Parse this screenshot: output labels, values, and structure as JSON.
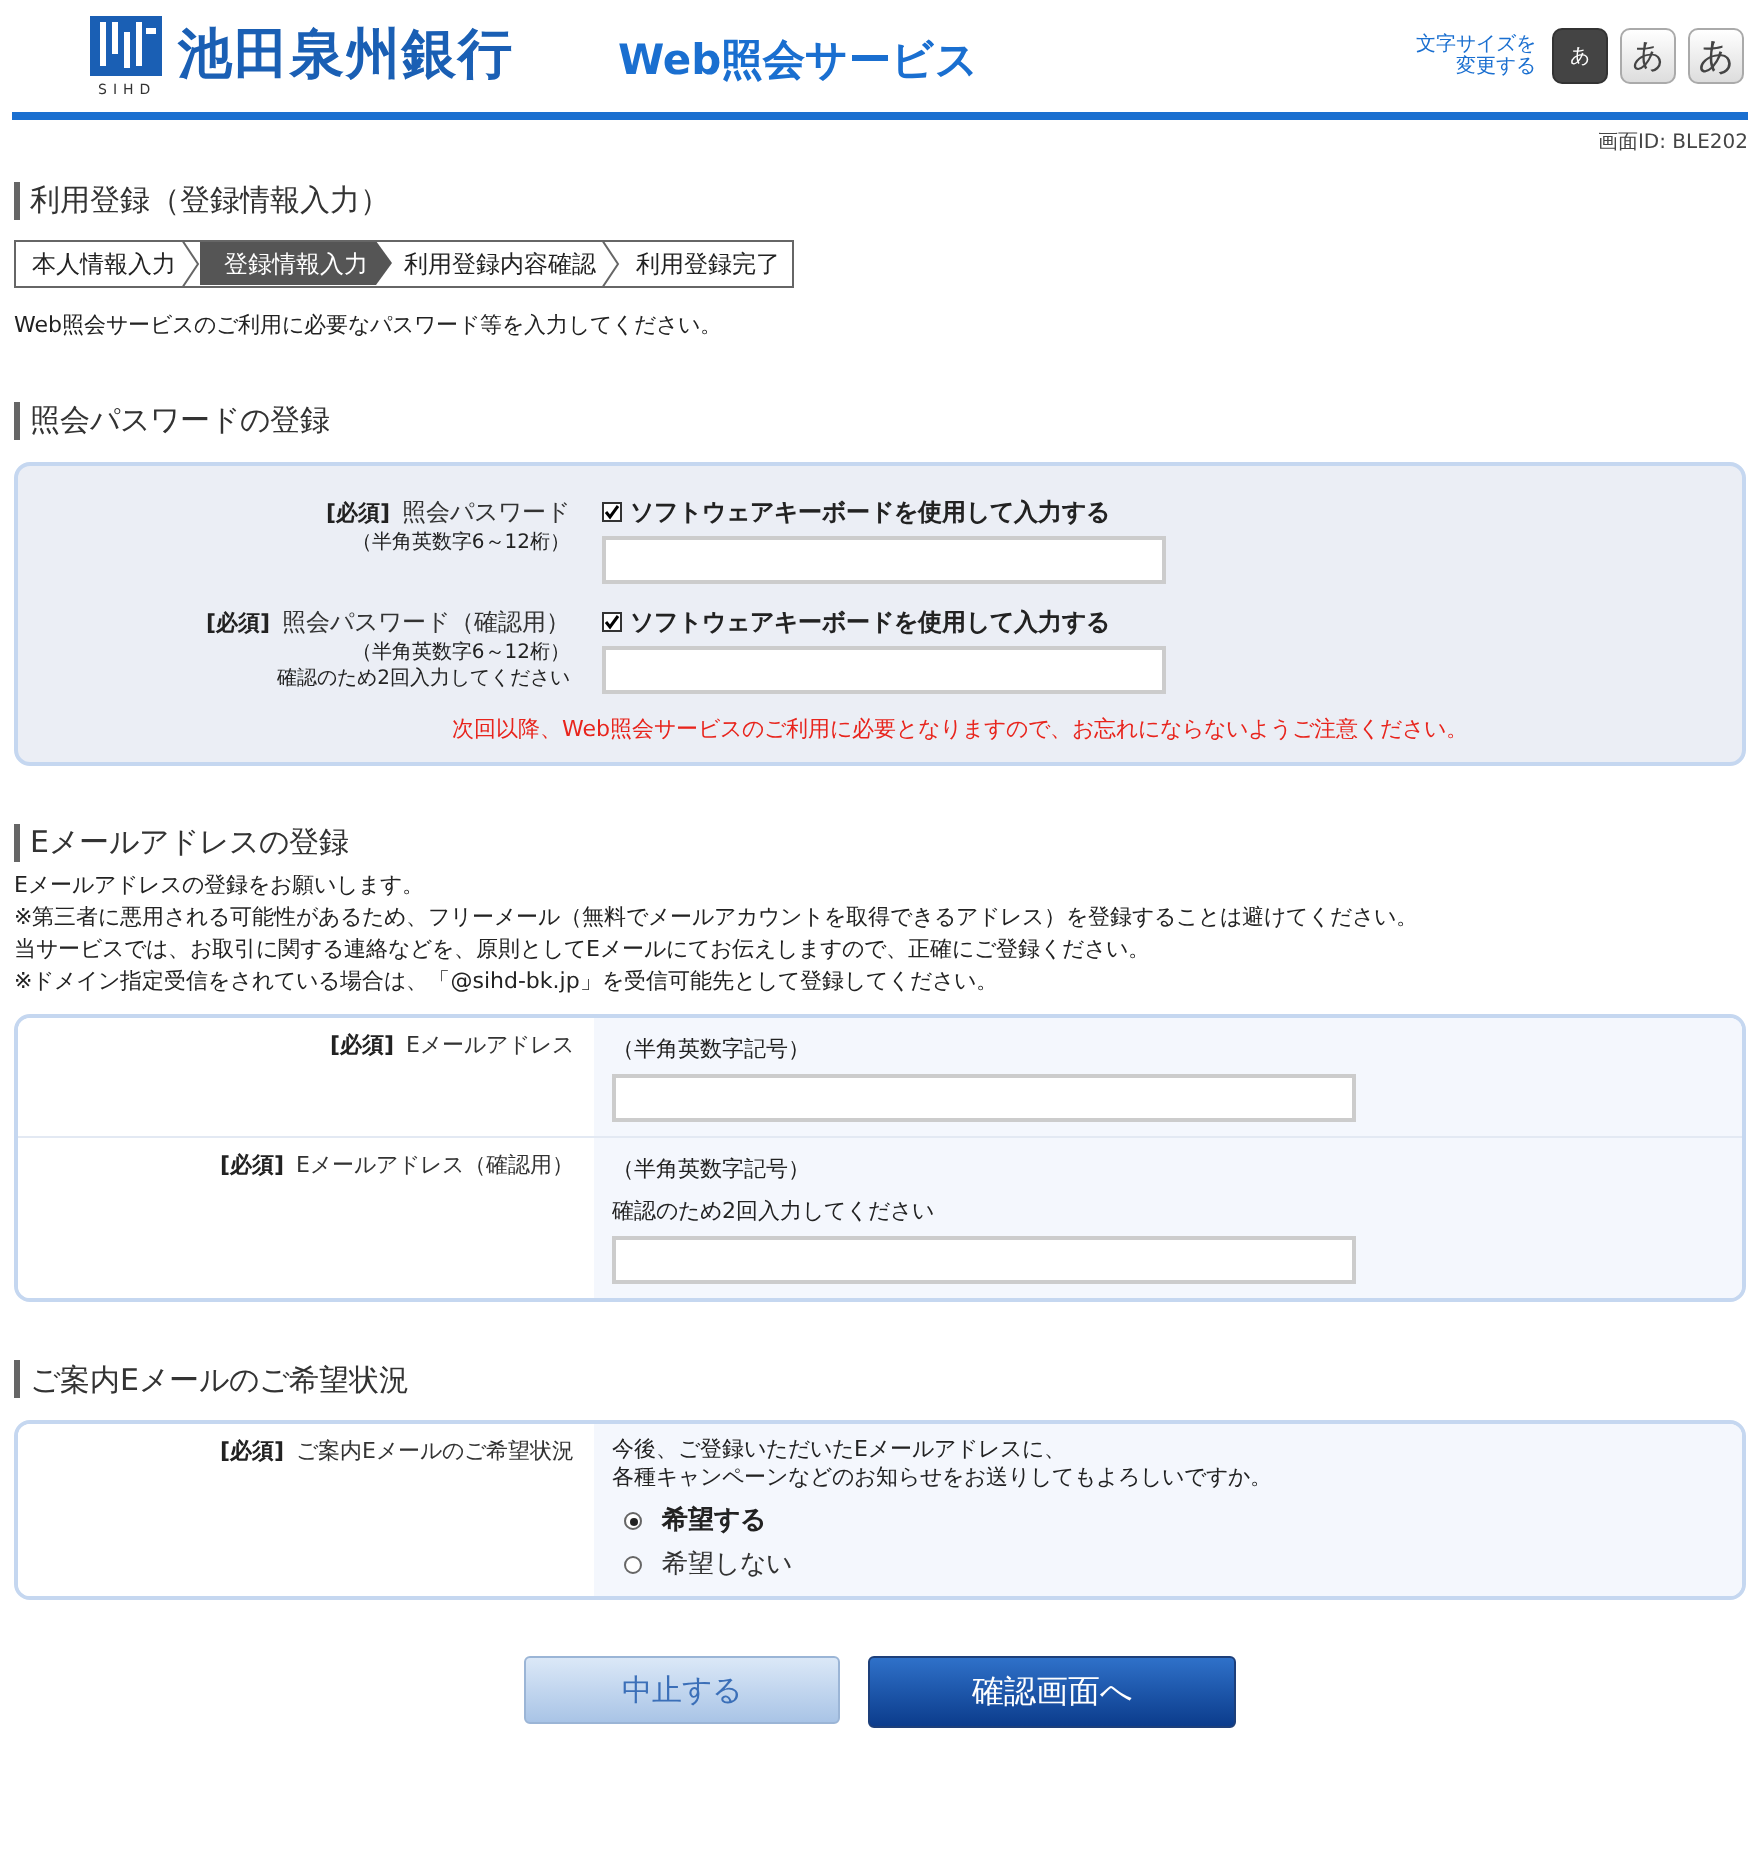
{
  "header": {
    "logo_text": "池田泉州銀行",
    "logo_sub": "SIHD",
    "service_title": "Web照会サービス",
    "font_size_label": [
      "文字サイズを",
      "変更する"
    ],
    "font_size_buttons": [
      {
        "label": "あ",
        "selected": true
      },
      {
        "label": "あ",
        "selected": false
      },
      {
        "label": "あ",
        "selected": false
      }
    ]
  },
  "screen_id": "画面ID: BLE202",
  "page_title": "利用登録（登録情報入力）",
  "steps": [
    {
      "label": "本人情報入力",
      "selected": false
    },
    {
      "label": "登録情報入力",
      "selected": true
    },
    {
      "label": "利用登録内容確認",
      "selected": false
    },
    {
      "label": "利用登録完了",
      "selected": false
    }
  ],
  "intro": "Web照会サービスのご利用に必要なパスワード等を入力してください。",
  "password_section": {
    "title": "照会パスワードの登録",
    "fields": [
      {
        "required": "[必須]",
        "label": "照会パスワード",
        "hints": [
          "（半角英数字6～12桁）"
        ],
        "checkbox_label": "ソフトウェアキーボードを使用して入力する",
        "checked": true
      },
      {
        "required": "[必須]",
        "label": "照会パスワード（確認用）",
        "hints": [
          "（半角英数字6～12桁）",
          "確認のため2回入力してください"
        ],
        "checkbox_label": "ソフトウェアキーボードを使用して入力する",
        "checked": true
      }
    ],
    "warning": "次回以降、Web照会サービスのご利用に必要となりますので、お忘れにならないようご注意ください。"
  },
  "email_section": {
    "title": "Eメールアドレスの登録",
    "notes": [
      "Eメールアドレスの登録をお願いします。",
      "※第三者に悪用される可能性があるため、フリーメール（無料でメールアカウントを取得できるアドレス）を登録することは避けてください。",
      "当サービスでは、お取引に関する連絡などを、原則としてEメールにてお伝えしますので、正確にご登録ください。",
      "※ドメイン指定受信をされている場合は、「@sihd-bk.jp」を受信可能先として登録してください。"
    ],
    "fields": [
      {
        "required": "[必須]",
        "label": "Eメールアドレス",
        "hints": [
          "（半角英数字記号）"
        ]
      },
      {
        "required": "[必須]",
        "label": "Eメールアドレス（確認用）",
        "hints": [
          "（半角英数字記号）",
          "確認のため2回入力してください"
        ]
      }
    ]
  },
  "guide_section": {
    "title": "ご案内Eメールのご希望状況",
    "required": "[必須]",
    "label": "ご案内Eメールのご希望状況",
    "question": [
      "今後、ご登録いただいたEメールアドレスに、",
      "各種キャンペーンなどのお知らせをお送りしてもよろしいですか。"
    ],
    "options": [
      {
        "label": "希望する",
        "selected": true
      },
      {
        "label": "希望しない",
        "selected": false
      }
    ]
  },
  "buttons": [
    {
      "label": "中止する",
      "kind": "secondary"
    },
    {
      "label": "確認画面へ",
      "kind": "primary"
    }
  ]
}
